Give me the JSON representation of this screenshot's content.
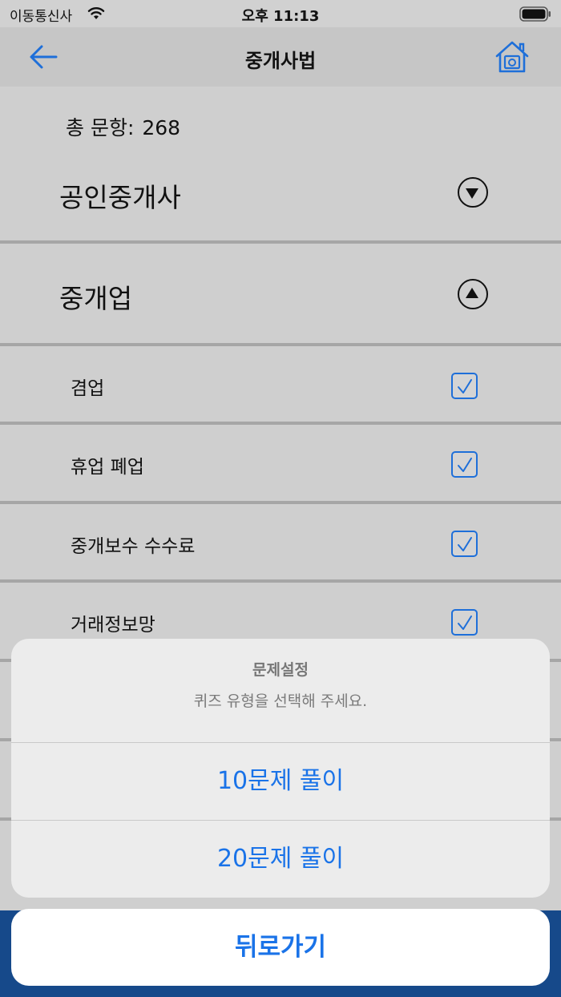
{
  "status_bar": {
    "carrier": "이동통신사",
    "time": "오후 11:13",
    "wifi_icon": "wifi-icon",
    "battery_icon": "battery-icon"
  },
  "nav": {
    "title": "중개사법",
    "back_icon": "arrow-left-icon",
    "home_icon": "home-icon",
    "accent_color": "#1e6fd9"
  },
  "summary": {
    "label": "총 문항:",
    "count": "268"
  },
  "sections": [
    {
      "label": "공인중개사",
      "state": "collapsed",
      "icon": "chevron-down-circle-icon"
    },
    {
      "label": "중개업",
      "state": "expanded",
      "icon": "chevron-up-circle-icon"
    }
  ],
  "items": [
    {
      "label": "겸업",
      "checked": true
    },
    {
      "label": "휴업 폐업",
      "checked": true
    },
    {
      "label": "중개보수 수수료",
      "checked": true
    },
    {
      "label": "거래정보망",
      "checked": true
    }
  ],
  "action_sheet": {
    "title": "문제설정",
    "message": "퀴즈 유형을 선택해 주세요.",
    "options": [
      {
        "label": "10문제 풀이"
      },
      {
        "label": "20문제 풀이"
      }
    ],
    "cancel_label": "뒤로가기",
    "button_color": "#1a73e8"
  }
}
